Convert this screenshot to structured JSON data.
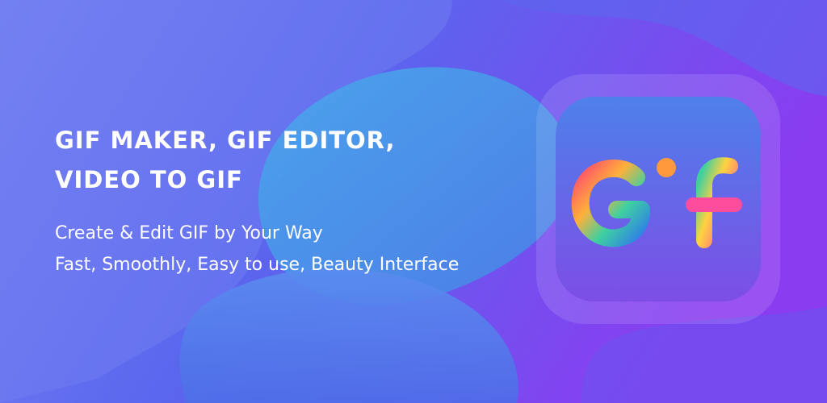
{
  "banner": {
    "headline_line1": "GIF MAKER, GIF EDITOR,",
    "headline_line2": "VIDEO TO GIF",
    "tagline_line1": "Create & Edit GIF by Your Way",
    "tagline_line2": "Fast, Smoothly, Easy to use, Beauty Interface"
  },
  "app_icon": {
    "icon": "gif-logo-icon",
    "letters": [
      "G",
      "I",
      "F"
    ]
  },
  "colors": {
    "background_start": "#6a78f0",
    "background_end": "#8b3df0",
    "blob": "#4fa3ea",
    "icon_top": "#4c7ce8",
    "icon_bottom": "#7e4fe6",
    "g_letter": "#f5a623",
    "i_letter": "#ffd23f",
    "f_letter": "#ff5aa5"
  }
}
